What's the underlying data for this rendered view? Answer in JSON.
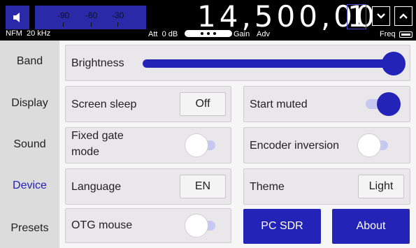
{
  "topbar": {
    "smeter_ticks": [
      "-90",
      "-60",
      "-30"
    ],
    "frequency_digits": "14,500,00",
    "frequency_cursor_digit": "1",
    "mode": "NFM",
    "bandwidth": "20 kHz",
    "att": "Att",
    "att_value": "0 dB",
    "gain": "Gain",
    "adv": "Adv",
    "freq": "Freq"
  },
  "sidebar": {
    "items": [
      {
        "label": "Band",
        "active": false
      },
      {
        "label": "Display",
        "active": false
      },
      {
        "label": "Sound",
        "active": false
      },
      {
        "label": "Device",
        "active": true
      },
      {
        "label": "Presets",
        "active": false
      }
    ]
  },
  "settings": {
    "brightness": {
      "label": "Brightness",
      "level": 1.0
    },
    "screen_sleep": {
      "label": "Screen sleep",
      "value": "Off"
    },
    "start_muted": {
      "label": "Start muted",
      "on": true
    },
    "fixed_gate": {
      "label_line1": "Fixed gate",
      "label_line2": "mode",
      "on": false
    },
    "encoder_inversion": {
      "label": "Encoder inversion",
      "on": false
    },
    "language": {
      "label": "Language",
      "value": "EN"
    },
    "theme": {
      "label": "Theme",
      "value": "Light"
    },
    "otg_mouse": {
      "label": "OTG mouse",
      "on": false
    },
    "pc_sdr": {
      "label": "PC SDR"
    },
    "about": {
      "label": "About"
    }
  },
  "colors": {
    "accent": "#2323b8",
    "active_sidebar": "#2323b8",
    "sidebar_bg": "#dcdcdc",
    "card_bg": "#e9e7e9"
  }
}
